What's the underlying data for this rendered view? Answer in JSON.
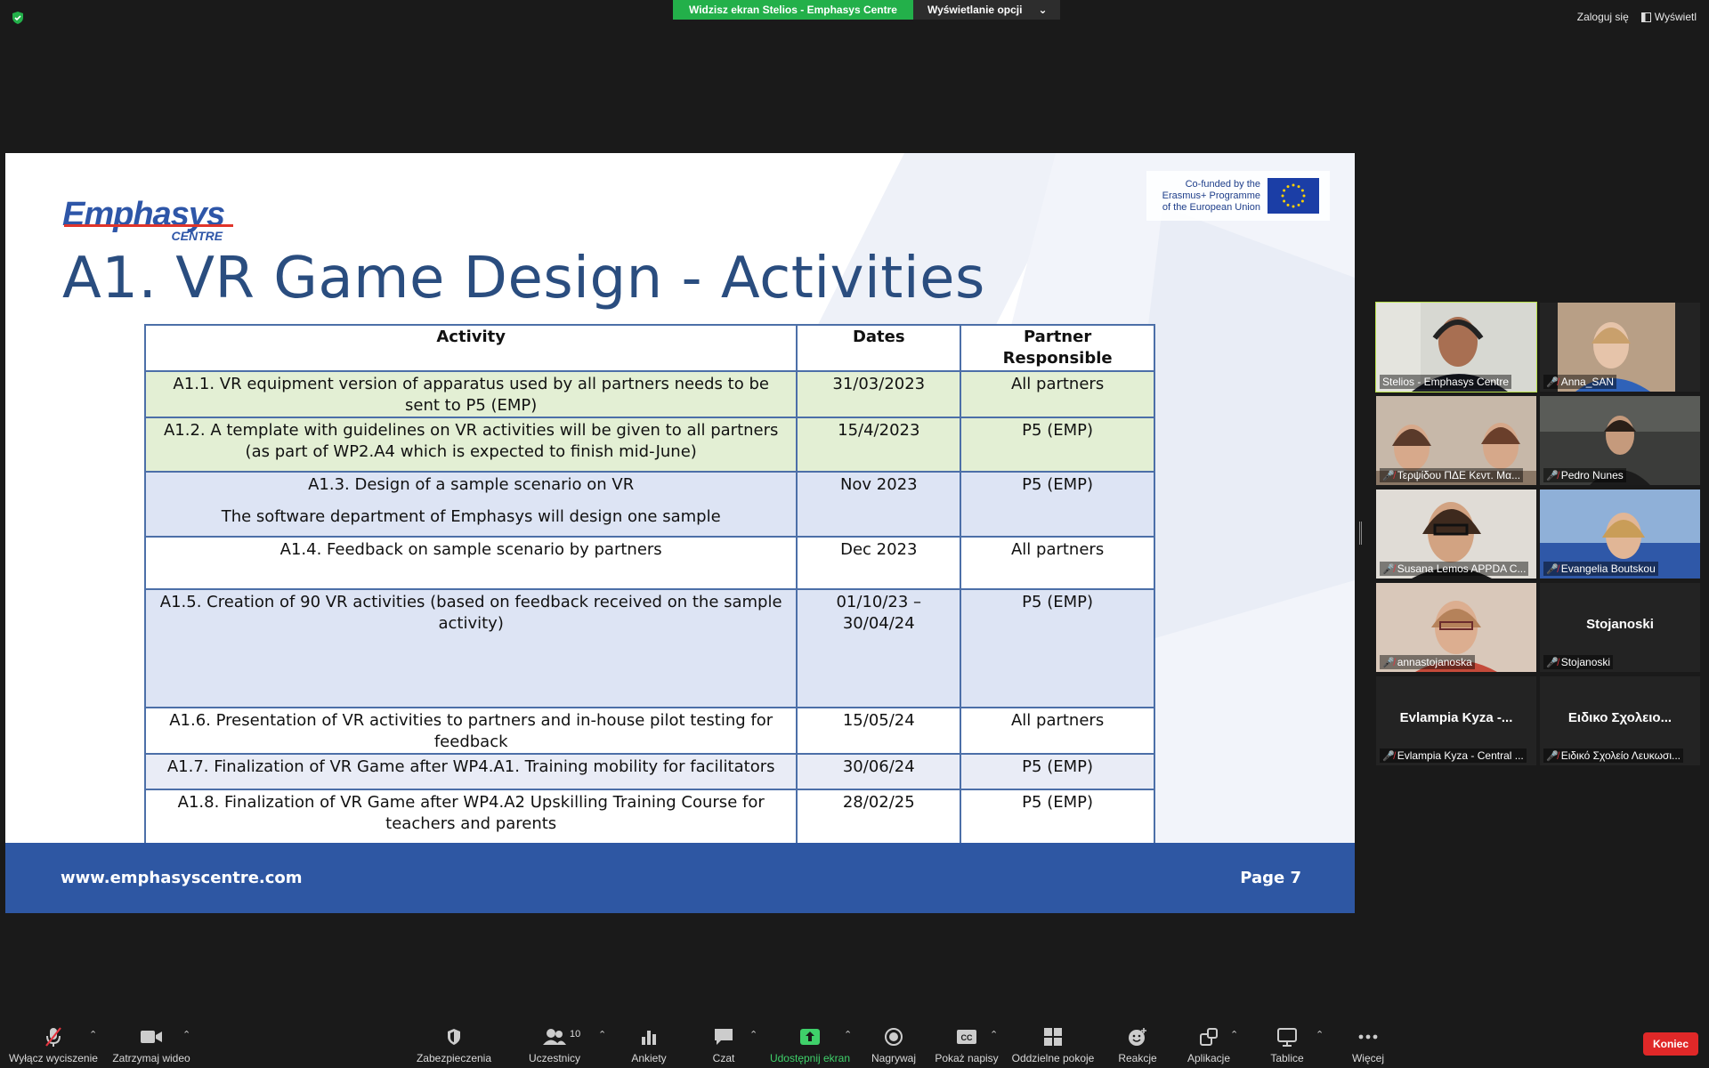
{
  "top_bar": {
    "share_banner": "Widzisz ekran Stelios - Emphasys Centre",
    "view_options": "Wyświetlanie opcji",
    "login": "Zaloguj się",
    "view": "Wyświetl"
  },
  "slide": {
    "logo_main": "Emphasys",
    "logo_sub": "CENTRE",
    "eu_text": [
      "Co-funded by the",
      "Erasmus+ Programme",
      "of the European Union"
    ],
    "title": "A1. VR Game Design - Activities",
    "table": {
      "headers": [
        "Activity",
        "Dates",
        "Partner Responsible"
      ],
      "rows": [
        {
          "activity": "A1.1. VR equipment version of apparatus used by all partners needs to be sent to P5 (EMP)",
          "dates": "31/03/2023",
          "partner": "All partners"
        },
        {
          "activity": "A1.2. A template with guidelines on VR activities will be given to all partners (as part of WP2.A4 which is expected to finish mid-June)",
          "dates": "15/4/2023",
          "partner": "P5 (EMP)"
        },
        {
          "activity": "A1.3. Design of a sample scenario on VR",
          "activity_2": "The software department of Emphasys will design one sample",
          "dates": "Nov 2023",
          "partner": "P5 (EMP)"
        },
        {
          "activity": "A1.4. Feedback on sample scenario by partners",
          "dates": "Dec 2023",
          "partner": "All partners"
        },
        {
          "activity": "A1.5. Creation of 90 VR activities (based on feedback received on the sample activity)",
          "dates": "01/10/23 – 30/04/24",
          "partner": "P5 (EMP)"
        },
        {
          "activity": "A1.6. Presentation of VR activities to partners and in-house pilot testing for feedback",
          "dates": "15/05/24",
          "partner": "All partners"
        },
        {
          "activity": "A1.7. Finalization of VR Game after WP4.A1. Training mobility for facilitators",
          "dates": "30/06/24",
          "partner": "P5 (EMP)"
        },
        {
          "activity": "A1.8. Finalization of VR Game after WP4.A2 Upskilling Training Course for teachers and parents",
          "dates": "28/02/25",
          "partner": "P5 (EMP)"
        }
      ]
    },
    "footer_url": "www.emphasyscentre.com",
    "footer_page": "Page 7"
  },
  "participants": [
    {
      "name": "Stelios - Emphasys Centre",
      "muted": false,
      "active": true
    },
    {
      "name": "Anna_SAN",
      "muted": true
    },
    {
      "name": "Τερψίδου ΠΔΕ Κεντ. Μα...",
      "muted": true
    },
    {
      "name": "Pedro Nunes",
      "muted": true
    },
    {
      "name": "Susana Lemos APPDA C...",
      "muted": true
    },
    {
      "name": "Evangelia Boutskou",
      "muted": true
    },
    {
      "name": "annastojanoska",
      "muted": true
    },
    {
      "name": "Stojanoski",
      "muted": true,
      "big": "Stojanoski"
    },
    {
      "name": "Evlampia Kyza - Central ...",
      "muted": true,
      "big": "Evlampia Kyza -..."
    },
    {
      "name": "Ειδικό Σχολείο Λευκωσι...",
      "muted": true,
      "big": "Ειδικο Σχολειο..."
    }
  ],
  "toolbar": {
    "unmute": "Wyłącz wyciszenie",
    "stop_video": "Zatrzymaj wideo",
    "security": "Zabezpieczenia",
    "participants": "Uczestnicy",
    "participants_count": "10",
    "polls": "Ankiety",
    "chat": "Czat",
    "share": "Udostępnij ekran",
    "record": "Nagrywaj",
    "captions": "Pokaż napisy",
    "breakout": "Oddzielne pokoje",
    "reactions": "Reakcje",
    "apps": "Aplikacje",
    "whiteboards": "Tablice",
    "more": "Więcej",
    "end": "Koniec"
  },
  "colors": {
    "share_green": "#23b04a",
    "slide_title": "#2a4d7f",
    "footer_blue": "#2e57a3",
    "active_speaker": "#b8e04a",
    "end_red": "#e02828"
  }
}
